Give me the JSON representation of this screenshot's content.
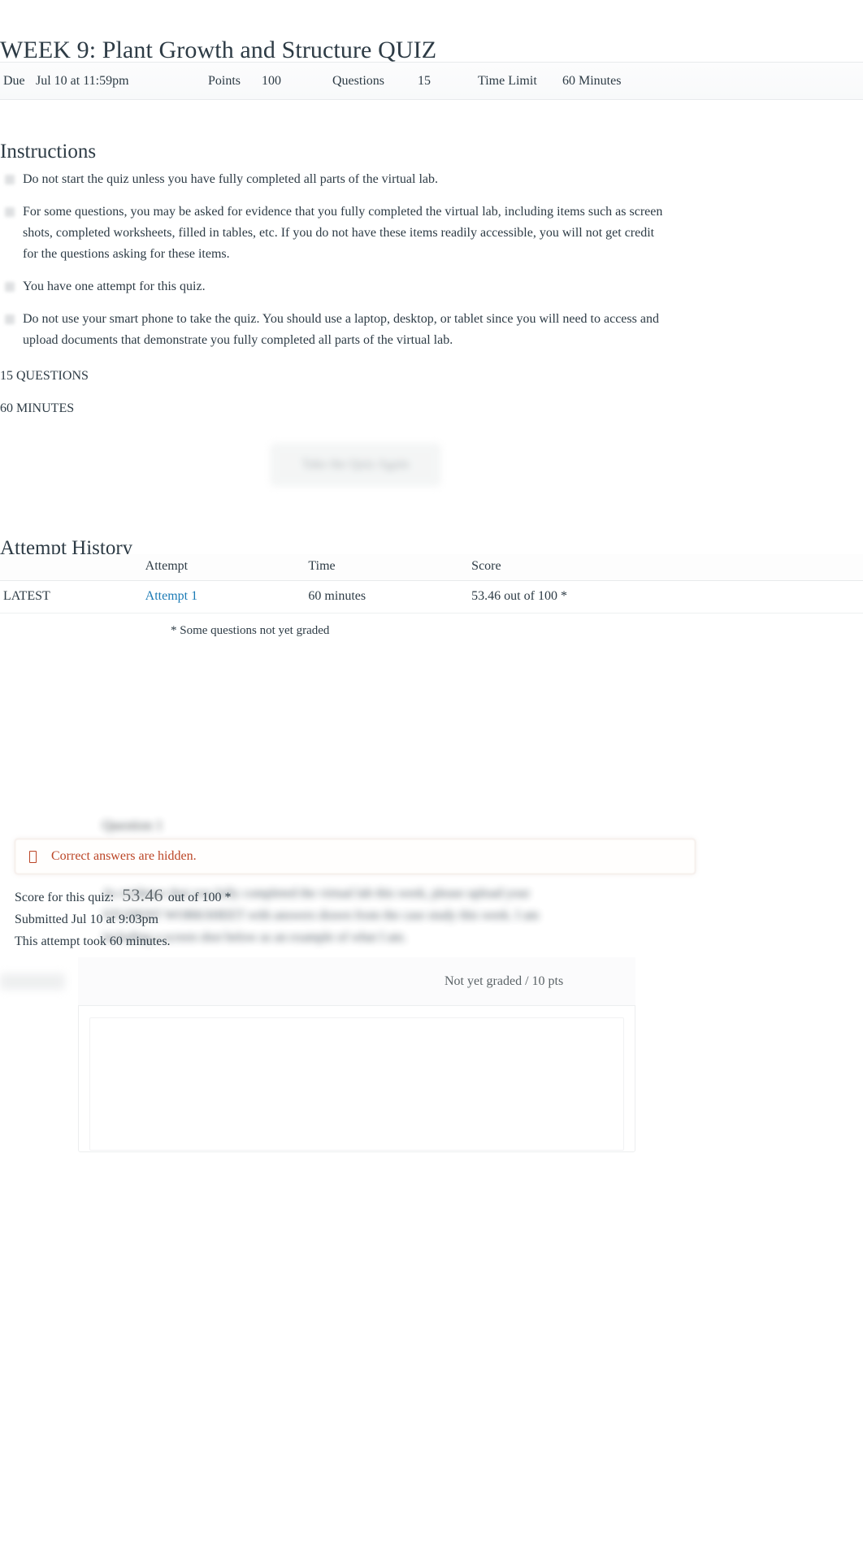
{
  "page_title": "WEEK 9: Plant Growth and Structure QUIZ",
  "quiz_header": {
    "due_label": "Due",
    "due_value": "Jul 10 at 11:59pm",
    "points_label": "Points",
    "points_value": "100",
    "questions_label": "Questions",
    "questions_value": "15",
    "time_limit_label": "Time Limit",
    "time_limit_value": "60 Minutes"
  },
  "instructions": {
    "heading": "Instructions",
    "items": [
      "Do not start the quiz unless you have fully completed all parts of the virtual lab.",
      "For some questions, you may be asked for evidence that you fully completed the virtual lab, including items such as screen shots, completed worksheets, filled in tables, etc. If you do not have these items readily accessible, you will not get credit for the questions asking for these items.",
      "You have one attempt for this quiz.",
      "Do not use your smart phone to take the quiz. You should use a laptop, desktop, or tablet since you will need to access and upload documents that demonstrate you fully completed all parts of the virtual lab."
    ],
    "questions_line": "15 QUESTIONS",
    "minutes_line": "60 MINUTES"
  },
  "retake_button_label": "Take the Quiz Again",
  "attempt_history": {
    "heading": "Attempt History",
    "columns": [
      "",
      "Attempt",
      "Time",
      "Score"
    ],
    "rows": [
      {
        "latest": "LATEST",
        "attempt": "Attempt 1",
        "time": "60 minutes",
        "score": "53.46 out of 100 *"
      }
    ],
    "footnote": "* Some questions not yet graded"
  },
  "alert": {
    "icon": "hidden-eye-icon",
    "message": "Correct answers are hidden.",
    "color": "#bb4526"
  },
  "score_summary": {
    "score_label": "Score for this quiz:",
    "score_value": "53.46",
    "score_suffix": "out of 100 *",
    "submitted": "Submitted Jul 10 at 9:03pm",
    "duration": "This attempt took 60 minutes."
  },
  "question": {
    "label": "Question 1",
    "points": "Not yet graded / 10 pts",
    "body": "As evidence that you fully completed the virtual lab this week, please upload your STUDENT WORKSHEET with answers drawn from the case study this week. I am including a screen shot below as an example of what I am."
  },
  "colors": {
    "link": "#1a7ab5",
    "alert": "#bb4526",
    "text": "#2d3b45",
    "muted": "#6d7478"
  }
}
